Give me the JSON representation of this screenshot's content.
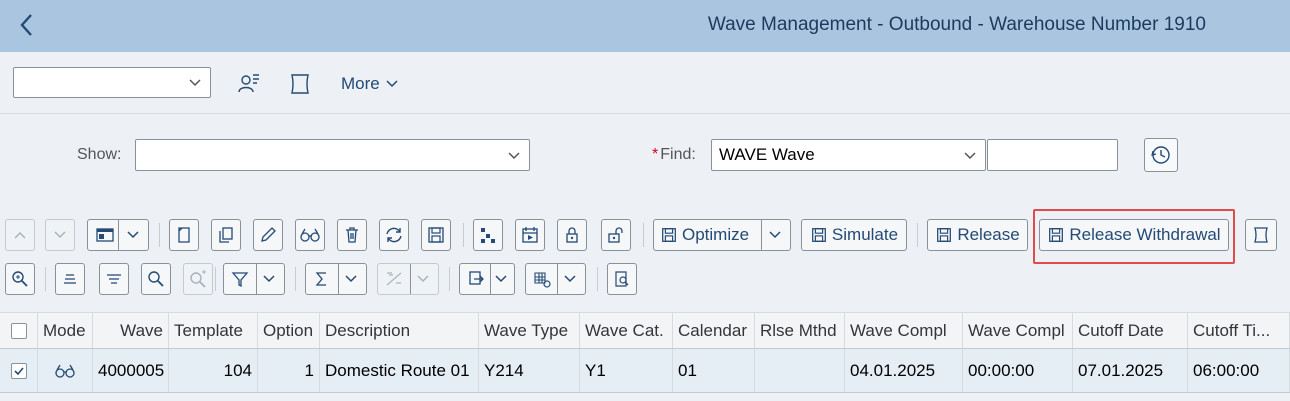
{
  "header": {
    "title": "Wave Management - Outbound - Warehouse Number 1910"
  },
  "toolbar": {
    "variant_value": "",
    "more_label": "More"
  },
  "filter": {
    "show_label": "Show:",
    "show_value": "",
    "find_required": "*",
    "find_label": "Find:",
    "find_value": "WAVE Wave",
    "find_text_value": ""
  },
  "actions": {
    "optimize_label": "Optimize",
    "simulate_label": "Simulate",
    "release_label": "Release",
    "release_withdrawal_label": "Release Withdrawal"
  },
  "table": {
    "columns": [
      "Mode",
      "Wave",
      "Template",
      "Option",
      "Description",
      "Wave Type",
      "Wave Cat.",
      "Calendar",
      "Rlse Mthd",
      "Wave Compl",
      "Wave Compl",
      "Cutoff Date",
      "Cutoff Ti..."
    ],
    "rows": [
      {
        "selected": true,
        "mode_icon": "glasses-icon",
        "wave": "4000005",
        "template": "104",
        "option": "1",
        "description": "Domestic Route 01",
        "wave_type": "Y214",
        "wave_cat": "Y1",
        "calendar": "01",
        "rlse_mthd": "",
        "wave_compl_date": "04.01.2025",
        "wave_compl_time": "00:00:00",
        "cutoff_date": "07.01.2025",
        "cutoff_time": "06:00:00"
      }
    ]
  },
  "colors": {
    "shell": "#a9c5e0",
    "accent": "#244a75",
    "highlight": "#e14b4b",
    "selected_row": "#e5edf5"
  }
}
